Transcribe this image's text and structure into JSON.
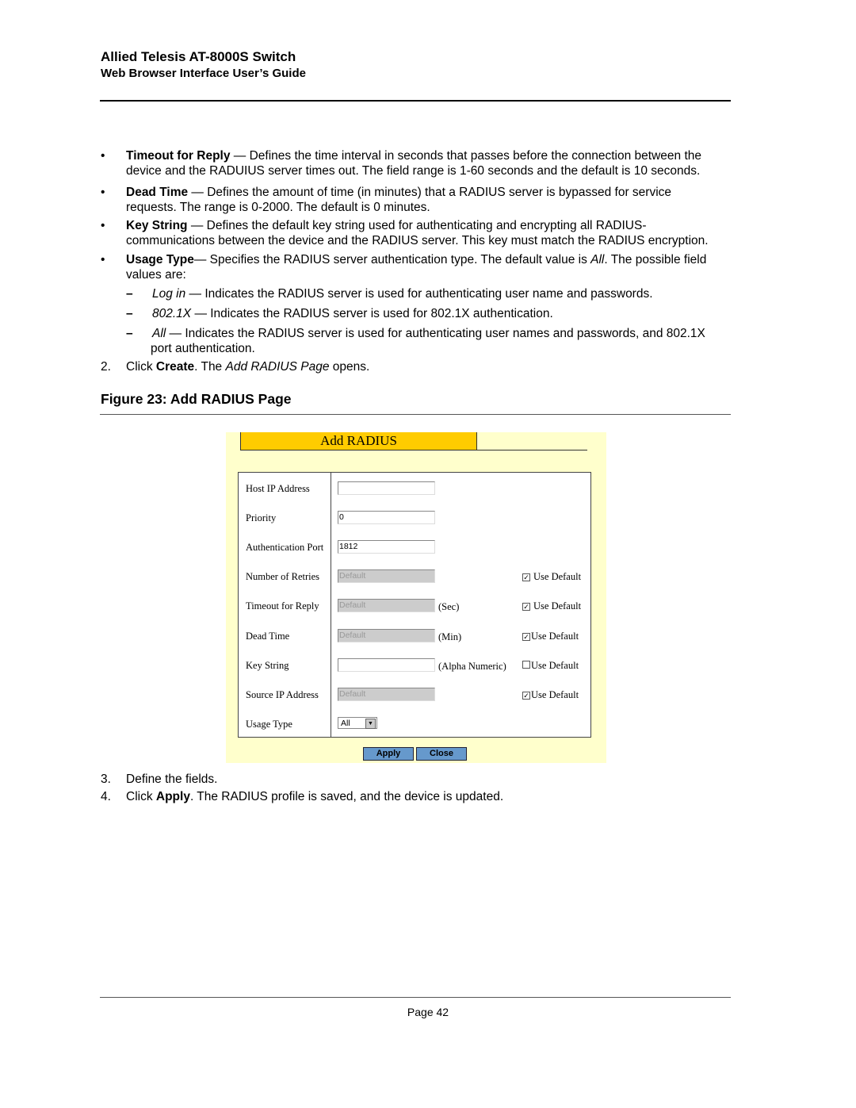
{
  "header": {
    "title": "Allied Telesis AT-8000S Switch",
    "subtitle": "Web Browser Interface User’s Guide"
  },
  "bullets": [
    {
      "marker": "•",
      "bold": "Timeout for Reply",
      "rest1": " — Defines the time interval in seconds that passes before the connection between the",
      "rest2": "device and the RADUIUS server times out. The field range is 1-60 seconds and the default is 10 seconds."
    },
    {
      "marker": "•",
      "bold": "Dead Time",
      "rest1": " — Defines the amount of time (in minutes) that a RADIUS server is bypassed for service",
      "rest2": "requests. The range is 0-2000. The default is 0 minutes."
    },
    {
      "marker": "•",
      "bold": "Key String",
      "rest1": " — Defines the default key string used for authenticating and encrypting all RADIUS-",
      "rest2": "communications between the device and the RADIUS server. This key must match the RADIUS encryption."
    },
    {
      "marker": "•",
      "bold": "Usage Type",
      "rest1": "— Specifies the RADIUS server authentication type. The default value is ",
      "italic": "All",
      "rest1b": ". The possible field",
      "rest2": "values are:"
    }
  ],
  "subitems": [
    {
      "marker": "–",
      "italic": "Log in",
      "rest1": " — Indicates the RADIUS server is used for authenticating user name and passwords."
    },
    {
      "marker": "–",
      "italic": "802.1X",
      "rest1": " — Indicates the RADIUS server is used for 802.1X authentication."
    },
    {
      "marker": "–",
      "italic": "All",
      "rest1": " — Indicates the RADIUS server is used for authenticating user names and passwords, and 802.1X",
      "rest2": "port authentication."
    }
  ],
  "step2": {
    "num": "2.",
    "pre": "Click ",
    "bold": "Create",
    "mid": ". The ",
    "italic": "Add RADIUS Page",
    "post": " opens."
  },
  "figure_caption": "Figure 23:  Add RADIUS Page",
  "panel": {
    "title": "Add RADIUS",
    "rows": [
      {
        "label": "Host IP Address",
        "value": "",
        "disabled": false
      },
      {
        "label": "Priority",
        "value": "0",
        "disabled": false
      },
      {
        "label": "Authentication Port",
        "value": "1812",
        "disabled": false
      },
      {
        "label": "Number of Retries",
        "value": "Default",
        "disabled": true,
        "checkbox": "Use Default",
        "checked": true
      },
      {
        "label": "Timeout for Reply",
        "value": "Default",
        "disabled": true,
        "unit": "(Sec)",
        "checkbox": "Use Default",
        "checked": true
      },
      {
        "label": "Dead Time",
        "value": "Default",
        "disabled": true,
        "unit": "(Min)",
        "checkbox": "Use Default",
        "checked": true
      },
      {
        "label": "Key String",
        "value": "",
        "disabled": false,
        "unit": "(Alpha Numeric)",
        "checkbox": "Use Default",
        "checked": false
      },
      {
        "label": "Source IP Address",
        "value": "Default",
        "disabled": true,
        "checkbox": "Use Default",
        "checked": true
      }
    ],
    "usage_type": {
      "label": "Usage Type",
      "selected": "All"
    },
    "apply": "Apply",
    "close": "Close",
    "colors": {
      "background": "#FFFFCC",
      "title_tab": "#FFCC00",
      "button": "#6699CC"
    }
  },
  "steps_after": [
    {
      "num": "3.",
      "pre": "Define the fields."
    },
    {
      "num": "4.",
      "pre": "Click ",
      "bold": "Apply",
      "post": ". The RADIUS profile is saved, and the device is updated."
    }
  ],
  "footer": {
    "page": "Page 42"
  }
}
